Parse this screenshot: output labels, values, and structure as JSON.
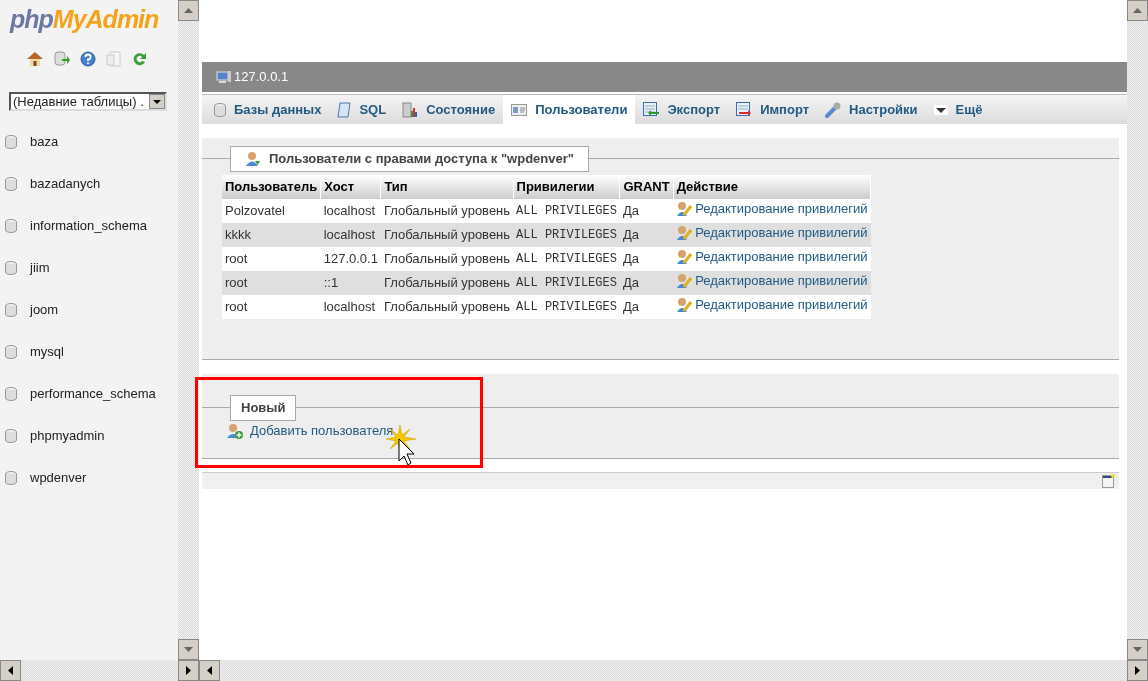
{
  "sidebar": {
    "logo_prefix": "php",
    "logo_name": "MyAdmin",
    "recent_tables": "(Недавние таблицы) .",
    "databases": [
      "baza",
      "bazadanych",
      "information_schema",
      "jiim",
      "joom",
      "mysql",
      "performance_schema",
      "phpmyadmin",
      "wpdenver"
    ]
  },
  "server": "127.0.0.1",
  "tabs": [
    {
      "label": "Базы данных",
      "kind": "db",
      "selected": false
    },
    {
      "label": "SQL",
      "kind": "sql",
      "selected": false
    },
    {
      "label": "Состояние",
      "kind": "status",
      "selected": false
    },
    {
      "label": "Пользователи",
      "kind": "users",
      "selected": true
    },
    {
      "label": "Экспорт",
      "kind": "export",
      "selected": false
    },
    {
      "label": "Импорт",
      "kind": "import",
      "selected": false
    },
    {
      "label": "Настройки",
      "kind": "settings",
      "selected": false
    },
    {
      "label": "Ещё",
      "kind": "more",
      "selected": false
    }
  ],
  "users_panel": {
    "title": "Пользователи с правами доступа к \"wpdenver\"",
    "columns": [
      "Пользователь",
      "Хост",
      "Тип",
      "Привилегии",
      "GRANT",
      "Действие"
    ],
    "rows": [
      [
        "Polzovatel",
        "localhost",
        "Глобальный уровень",
        "ALL PRIVILEGES",
        "Да",
        "Редактирование привилегий"
      ],
      [
        "kkkk",
        "localhost",
        "Глобальный уровень",
        "ALL PRIVILEGES",
        "Да",
        "Редактирование привилегий"
      ],
      [
        "root",
        "127.0.0.1",
        "Глобальный уровень",
        "ALL PRIVILEGES",
        "Да",
        "Редактирование привилегий"
      ],
      [
        "root",
        "::1",
        "Глобальный уровень",
        "ALL PRIVILEGES",
        "Да",
        "Редактирование привилегий"
      ],
      [
        "root",
        "localhost",
        "Глобальный уровень",
        "ALL PRIVILEGES",
        "Да",
        "Редактирование привилегий"
      ]
    ]
  },
  "new_panel": {
    "title": "Новый",
    "link": "Добавить пользователя"
  }
}
